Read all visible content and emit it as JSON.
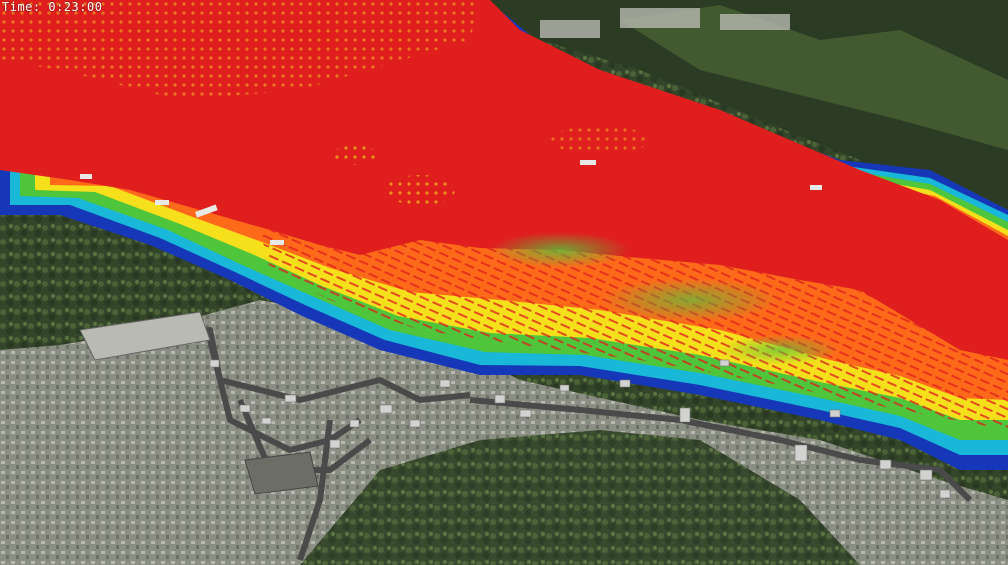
{
  "hud": {
    "time_label": "Time:",
    "time_value": "0:23:00"
  },
  "legend_colors": {
    "deep_flow": "#e01e1e",
    "high": "#ff6a1a",
    "medium_high": "#f6e01c",
    "medium": "#4ec53a",
    "low": "#19b7d8",
    "shallow": "#1638b8"
  },
  "terrain_colors": {
    "forest_dark": "#24331f",
    "forest_light": "#5e7a3c",
    "urban": "#8c8f86",
    "road": "#555555",
    "building_roof": "#cfcfcf"
  }
}
